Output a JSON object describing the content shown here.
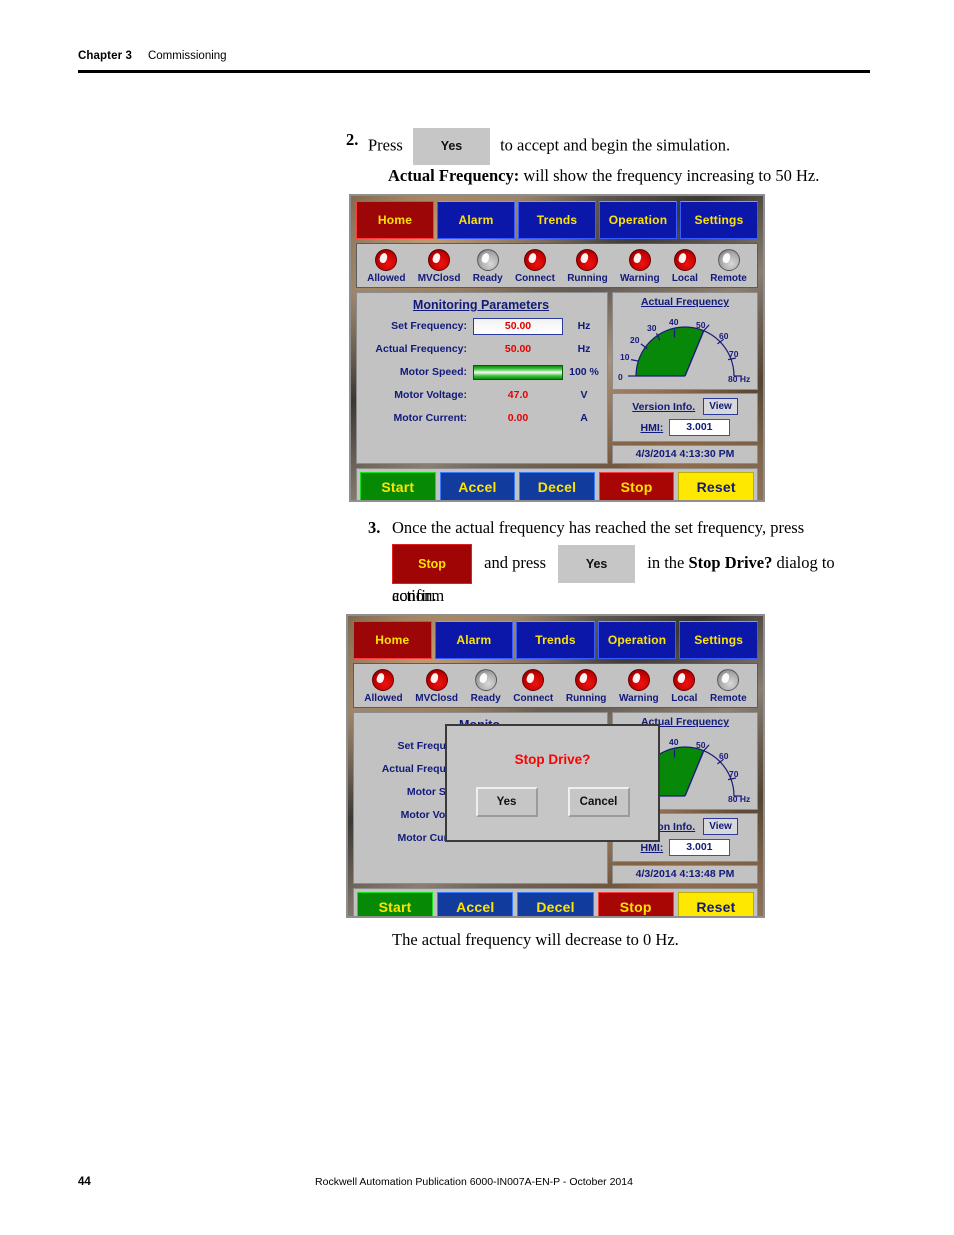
{
  "header": {
    "chapter": "Chapter 3",
    "topic": "Commissioning"
  },
  "steps": {
    "step2": {
      "number": "2.",
      "text_before": "Press",
      "button_label": "Yes",
      "text_after": "to accept and begin the simulation.",
      "note_bold": "Actual Frequency:",
      "note_rest": "will show the frequency increasing to 50 Hz."
    },
    "step3": {
      "number": "3.",
      "line1": "Once the actual frequency has reached the set frequency, press",
      "stop_button_label": "Stop",
      "text_mid": "and press",
      "yes_button_label": "Yes",
      "text_after": "in the",
      "dialog_name": "Stop Drive?",
      "text_end": "dialog to confirm",
      "line3": "action."
    },
    "closing": "The actual frequency will decrease to 0 Hz."
  },
  "hmi": {
    "tabs": [
      {
        "label": "Home",
        "active": true
      },
      {
        "label": "Alarm",
        "active": false
      },
      {
        "label": "Trends",
        "active": false
      },
      {
        "label": "Operation",
        "active": false
      },
      {
        "label": "Settings",
        "active": false
      }
    ],
    "leds": [
      {
        "label": "Allowed",
        "state": "red"
      },
      {
        "label": "MVClosd",
        "state": "red"
      },
      {
        "label": "Ready",
        "state": "grey"
      },
      {
        "label": "Connect",
        "state": "red"
      },
      {
        "label": "Running",
        "state": "red"
      },
      {
        "label": "Warning",
        "state": "red"
      },
      {
        "label": "Local",
        "state": "red"
      },
      {
        "label": "Remote",
        "state": "grey"
      }
    ],
    "monitor_title": "Monitoring Parameters",
    "parameters": [
      {
        "label": "Set Frequency:",
        "value": "50.00",
        "unit": "Hz",
        "style": "boxed"
      },
      {
        "label": "Actual Frequency:",
        "value": "50.00",
        "unit": "Hz",
        "style": "flat"
      },
      {
        "label": "Motor Speed:",
        "value": "",
        "unit": "100 %",
        "style": "bar"
      },
      {
        "label": "Motor Voltage:",
        "value": "47.0",
        "unit": "V",
        "style": "flat"
      },
      {
        "label": "Motor Current:",
        "value": "0.00",
        "unit": "A",
        "style": "flat"
      }
    ],
    "gauge_title": "Actual Frequency",
    "version": {
      "title": "Version Info.",
      "view_label": "View",
      "hmi_label": "HMI:",
      "hmi_value": "3.001"
    },
    "timestamp_1": "4/3/2014 4:13:30 PM",
    "timestamp_2": "4/3/2014 4:13:48 PM",
    "actions": [
      {
        "label": "Start",
        "kind": "start"
      },
      {
        "label": "Accel",
        "kind": "blue"
      },
      {
        "label": "Decel",
        "kind": "blue"
      },
      {
        "label": "Stop",
        "kind": "stop"
      },
      {
        "label": "Reset",
        "kind": "reset"
      }
    ],
    "clipped_labels": [
      "Monito",
      "Set Frequenc",
      "Actual Frequenc",
      "Motor Spee",
      "Motor Voltag",
      "Motor Curren"
    ],
    "dialog": {
      "title": "Stop Drive?",
      "yes_label": "Yes",
      "cancel_label": "Cancel"
    },
    "colors": {
      "tab_active": "#9d0606",
      "tab_inactive": "#0a17a8",
      "tab_text": "#ffe400",
      "panel_grey": "#c2c2c2",
      "label_blue": "#111a7a",
      "value_red": "#e80000",
      "bar_green": "#3fc13f",
      "dialog_title_red": "#ff0000"
    }
  },
  "chart_data": {
    "type": "gauge",
    "title": "Actual Frequency",
    "unit": "Hz",
    "ticks": [
      0,
      10,
      20,
      30,
      40,
      50,
      60,
      70,
      80
    ],
    "min": 0,
    "max": 80,
    "value": 50,
    "end_tick_label": "80 Hz",
    "fill_color": "#088808",
    "instances": [
      {
        "name": "step2-home-screen",
        "value": 50
      },
      {
        "name": "step3-stop-dialog-screen",
        "value": 50
      }
    ]
  },
  "footer": {
    "page_number": "44",
    "publication": "Rockwell Automation Publication 6000-IN007A-EN-P - October 2014"
  }
}
